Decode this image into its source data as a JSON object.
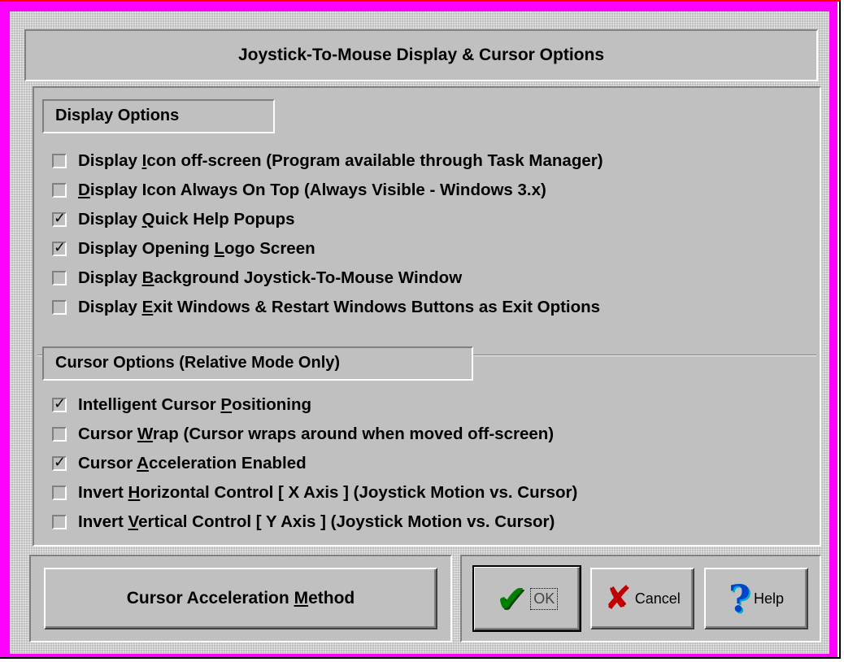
{
  "title": "Joystick-To-Mouse Display & Cursor Options",
  "display_group": {
    "label": "Display Options",
    "options": [
      {
        "pre": "Display ",
        "key": "I",
        "post": "con off-screen (Program available through Task Manager)",
        "checked": false
      },
      {
        "pre": "",
        "key": "D",
        "post": "isplay Icon Always On Top (Always Visible - Windows 3.x)",
        "checked": false
      },
      {
        "pre": "Display ",
        "key": "Q",
        "post": "uick Help Popups",
        "checked": true
      },
      {
        "pre": "Display Opening ",
        "key": "L",
        "post": "ogo Screen",
        "checked": true
      },
      {
        "pre": "Display ",
        "key": "B",
        "post": "ackground Joystick-To-Mouse Window",
        "checked": false
      },
      {
        "pre": "Display ",
        "key": "E",
        "post": "xit Windows & Restart Windows Buttons as Exit Options",
        "checked": false
      }
    ]
  },
  "cursor_group": {
    "label": "Cursor Options (Relative Mode Only)",
    "options": [
      {
        "pre": "Intelligent Cursor ",
        "key": "P",
        "post": "ositioning",
        "checked": true
      },
      {
        "pre": "Cursor ",
        "key": "W",
        "post": "rap (Cursor wraps around when moved off-screen)",
        "checked": false
      },
      {
        "pre": "Cursor ",
        "key": "A",
        "post": "cceleration Enabled",
        "checked": true
      },
      {
        "pre": "Invert ",
        "key": "H",
        "post": "orizontal Control [ X Axis ] (Joystick Motion vs. Cursor)",
        "checked": false
      },
      {
        "pre": "Invert ",
        "key": "V",
        "post": "ertical Control [ Y Axis ] (Joystick Motion vs. Cursor)",
        "checked": false
      }
    ]
  },
  "buttons": {
    "accel": {
      "pre": "Cursor Acceleration ",
      "key": "M",
      "post": "ethod"
    },
    "ok": "OK",
    "cancel": "Cancel",
    "help": "Help"
  },
  "icons": {
    "ok": "green-checkmark-icon",
    "cancel": "red-x-icon",
    "help": "blue-question-mark-icon"
  },
  "colors": {
    "border_accent": "#ff00ff",
    "face": "#c0c0c0"
  }
}
